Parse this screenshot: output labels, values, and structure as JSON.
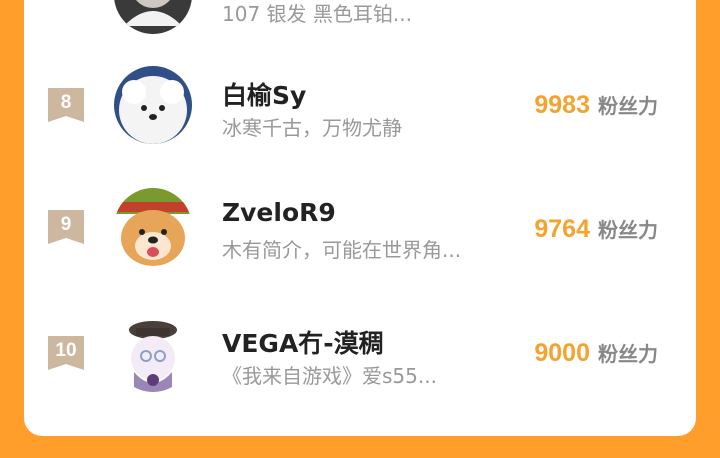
{
  "partial_row": {
    "bio": "107 银发 黑色耳铂..."
  },
  "rows": [
    {
      "rank": "8",
      "name": "白榆Sy",
      "bio": "冰寒千古，万物尤静",
      "fans": "9983",
      "fans_label": "粉丝力"
    },
    {
      "rank": "9",
      "name": "ZveloR9",
      "bio": "木有简介，可能在世界角...",
      "fans": "9764",
      "fans_label": "粉丝力"
    },
    {
      "rank": "10",
      "name": "VEGA冇-漠稠",
      "bio": "《我来自游戏》爱s55...",
      "fans": "9000",
      "fans_label": "粉丝力"
    }
  ],
  "colors": {
    "background": "#FF9E2B",
    "fans_value": "#F3A32E",
    "rank_badge": "#CDB79E"
  }
}
